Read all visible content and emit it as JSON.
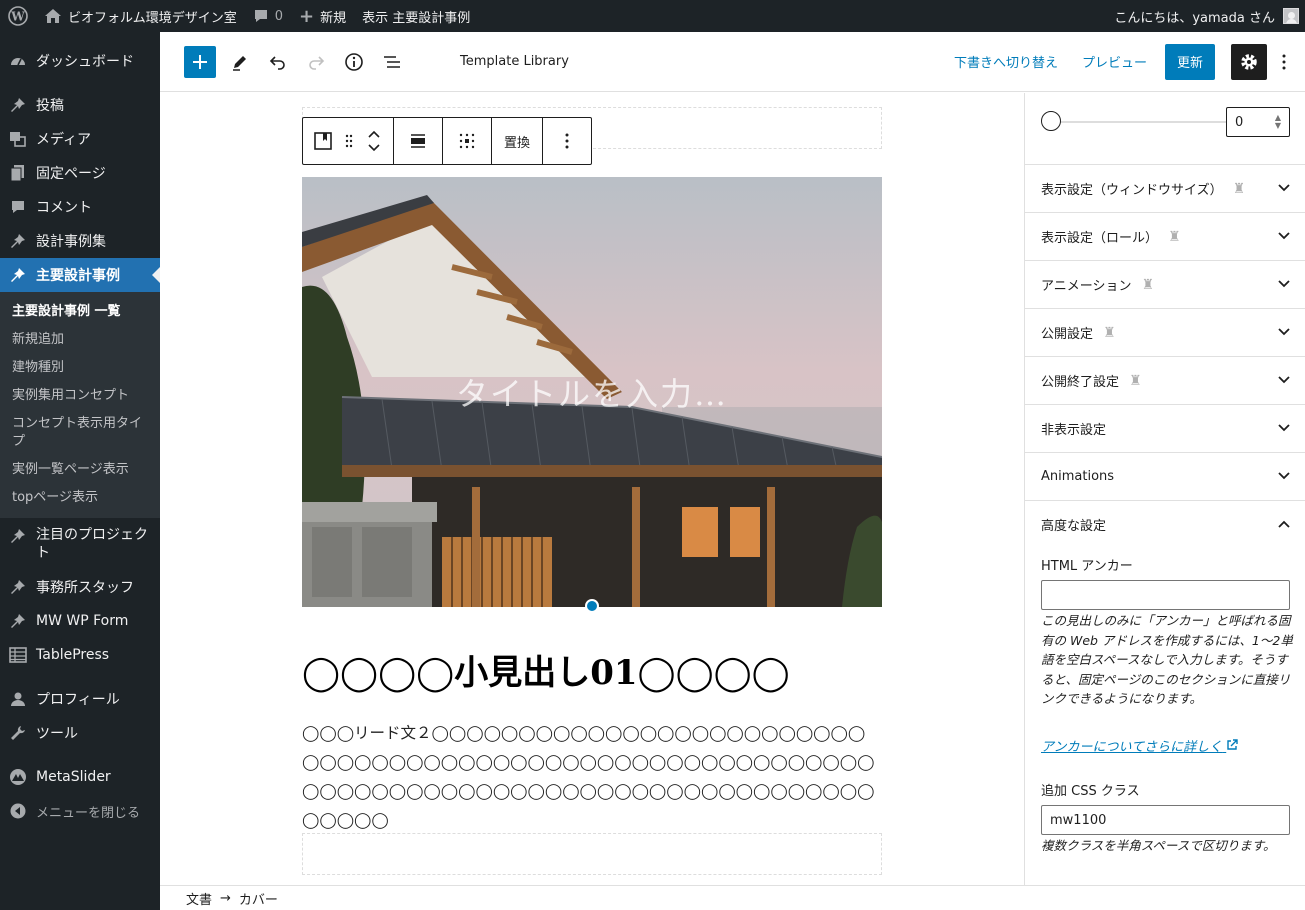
{
  "adminbar": {
    "site_name": "ビオフォルム環境デザイン室",
    "comments_count": "0",
    "new_label": "新規",
    "view_label": "表示 主要設計事例",
    "greeting": "こんにちは、yamada さん"
  },
  "menu": {
    "dashboard": "ダッシュボード",
    "posts": "投稿",
    "media": "メディア",
    "pages": "固定ページ",
    "comments": "コメント",
    "design_cases": "設計事例集",
    "main_cases": "主要設計事例",
    "sub": [
      "主要設計事例 一覧",
      "新規追加",
      "建物種別",
      "実例集用コンセプト",
      "コンセプト表示用タイプ",
      "実例一覧ページ表示",
      "topページ表示"
    ],
    "projects": "注目のプロジェクト",
    "staff": "事務所スタッフ",
    "mwwpform": "MW WP Form",
    "tablepress": "TablePress",
    "profile": "プロフィール",
    "tools": "ツール",
    "metaslider": "MetaSlider",
    "collapse": "メニューを閉じる"
  },
  "header": {
    "doc_title": "Template Library",
    "switch_draft": "下書きへ切り替え",
    "preview": "プレビュー",
    "update": "更新"
  },
  "block_toolbar": {
    "replace": "置換"
  },
  "canvas": {
    "cover_title_placeholder": "タイトルを入力…",
    "heading": "◯◯◯◯小見出し01◯◯◯◯",
    "lead": "◯◯◯リード文２◯◯◯◯◯◯◯◯◯◯◯◯◯◯◯◯◯◯◯◯◯◯◯◯◯◯◯◯◯◯◯◯◯◯◯◯◯◯◯◯◯◯◯◯◯◯◯◯◯◯◯◯◯◯◯◯◯◯◯◯◯◯◯◯◯◯◯◯◯◯◯◯◯◯◯◯◯◯◯◯◯◯◯◯◯◯◯◯◯◯◯◯◯◯◯◯"
  },
  "breadcrumb": {
    "root": "文書",
    "current": "カバー"
  },
  "settings": {
    "range_value": "0",
    "panels": [
      "表示設定（ウィンドウサイズ）",
      "表示設定（ロール）",
      "アニメーション",
      "公開設定",
      "公開終了設定",
      "非表示設定",
      "Animations",
      "高度な設定"
    ],
    "html_anchor_label": "HTML アンカー",
    "html_anchor_value": "",
    "anchor_help": "この見出しのみに「アンカー」と呼ばれる固有の Web アドレスを作成するには、1〜2単語を空白スペースなしで入力します。そうすると、固定ページのこのセクションに直接リンクできるようになります。",
    "anchor_link": "アンカーについてさらに詳しく",
    "css_label": "追加 CSS クラス",
    "css_value": "mw1100",
    "css_help": "複数クラスを半角スペースで区切ります。"
  }
}
